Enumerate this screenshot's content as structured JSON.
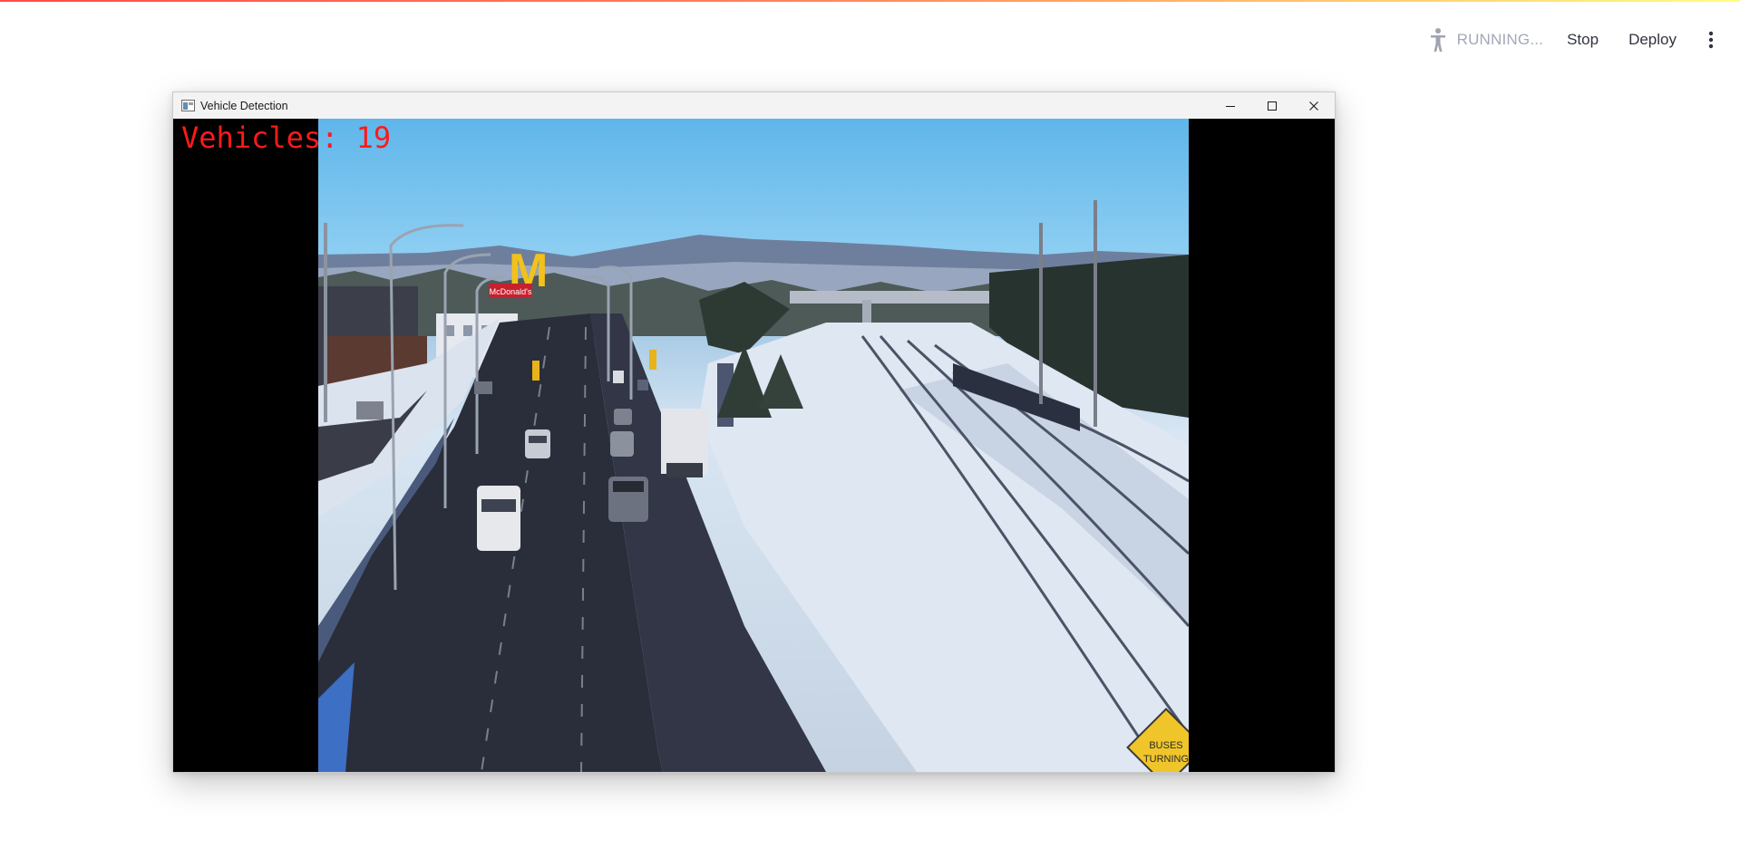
{
  "header": {
    "status": "RUNNING...",
    "stop_label": "Stop",
    "deploy_label": "Deploy",
    "icons": [
      "running-man-icon",
      "kebab-menu-icon"
    ]
  },
  "window": {
    "title": "Vehicle Detection",
    "controls": [
      "minimize-icon",
      "maximize-icon",
      "close-icon"
    ]
  },
  "overlay": {
    "label": "Vehicles:",
    "count": "19",
    "color": "#ff1a1a"
  },
  "scene": {
    "sign_brand": "McDonald's",
    "road_sign_line1": "BUSES",
    "road_sign_line2": "TURNING"
  }
}
